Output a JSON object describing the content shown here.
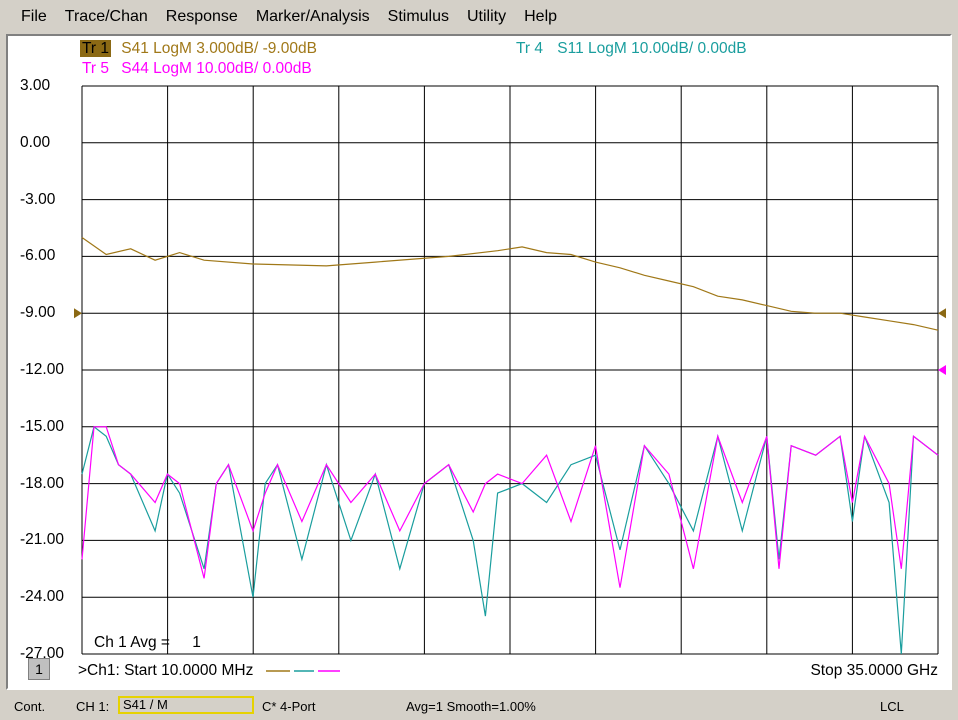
{
  "menu": [
    "File",
    "Trace/Chan",
    "Response",
    "Marker/Analysis",
    "Stimulus",
    "Utility",
    "Help"
  ],
  "traces": {
    "tr1": {
      "name": "Tr 1",
      "desc": "S41 LogM 3.000dB/ -9.00dB",
      "color": "#a07818"
    },
    "tr4": {
      "name": "Tr 4",
      "desc": "S11 LogM 10.00dB/  0.00dB",
      "color": "#1a9e9e"
    },
    "tr5": {
      "name": "Tr 5",
      "desc": "S44 LogM 10.00dB/  0.00dB",
      "color": "#ff00ff"
    }
  },
  "y_scale_labels": [
    "3.00",
    "0.00",
    "-3.00",
    "-6.00",
    "-9.00",
    "-12.00",
    "-15.00",
    "-18.00",
    "-21.00",
    "-24.00",
    "-27.00"
  ],
  "avg_label": "Ch 1 Avg =",
  "avg_value": "1",
  "channel_box": "1",
  "start_text": ">Ch1:  Start  10.0000 MHz",
  "stop_text": "Stop  35.0000 GHz",
  "status": {
    "mode": "Cont.",
    "channel": "CH 1:",
    "meas": "S41 / M",
    "cal": "C* 4-Port",
    "avg_smooth": "Avg=1 Smooth=1.00%",
    "ref": "LCL"
  },
  "chart_data": {
    "type": "line",
    "xlabel": "",
    "ylabel": "",
    "x_range_ghz": [
      0.01,
      35.0
    ],
    "ylim": [
      -27,
      3
    ],
    "grid": true,
    "series": [
      {
        "name": "S41",
        "color": "#a07818",
        "x": [
          0.01,
          1,
          2,
          3,
          4,
          5,
          7,
          10,
          12,
          15,
          17,
          18,
          19,
          20,
          21,
          22,
          23,
          24,
          25,
          26,
          27,
          28,
          29,
          30,
          31,
          32,
          33,
          34,
          35
        ],
        "y": [
          -5.0,
          -5.9,
          -5.6,
          -6.2,
          -5.8,
          -6.2,
          -6.4,
          -6.5,
          -6.3,
          -6.0,
          -5.7,
          -5.5,
          -5.8,
          -5.9,
          -6.3,
          -6.6,
          -7.0,
          -7.3,
          -7.6,
          -8.1,
          -8.3,
          -8.6,
          -8.9,
          -9.0,
          -9.0,
          -9.2,
          -9.4,
          -9.6,
          -9.9
        ]
      },
      {
        "name": "S11",
        "color": "#1a9e9e",
        "x": [
          0.01,
          0.5,
          1,
          1.5,
          2,
          3,
          3.5,
          4,
          5,
          5.5,
          6,
          7,
          7.5,
          8,
          9,
          10,
          11,
          12,
          13,
          14,
          15,
          16,
          16.5,
          17,
          18,
          19,
          20,
          21,
          22,
          23,
          24,
          25,
          26,
          27,
          28,
          28.5,
          29,
          30,
          31,
          31.5,
          32,
          33,
          33.5,
          34,
          35
        ],
        "y": [
          -17.5,
          -15,
          -15.5,
          -17.0,
          -17.5,
          -20.5,
          -17.5,
          -18.5,
          -22.5,
          -18.0,
          -17.0,
          -24.0,
          -18.0,
          -17.0,
          -22.0,
          -17.0,
          -21.0,
          -17.5,
          -22.5,
          -18.0,
          -17.0,
          -21.0,
          -25.0,
          -18.5,
          -18.0,
          -19.0,
          -17.0,
          -16.5,
          -21.5,
          -16.0,
          -18.0,
          -20.5,
          -15.5,
          -20.5,
          -15.5,
          -22.0,
          -16.0,
          -16.5,
          -15.5,
          -20.0,
          -15.5,
          -19.0,
          -27.0,
          -15.5,
          -16.5
        ]
      },
      {
        "name": "S44",
        "color": "#ff00ff",
        "x": [
          0.01,
          0.5,
          1,
          1.5,
          2,
          3,
          3.5,
          4,
          5,
          5.5,
          6,
          7,
          7.5,
          8,
          9,
          10,
          11,
          12,
          13,
          14,
          15,
          16,
          16.5,
          17,
          18,
          19,
          20,
          21,
          22,
          23,
          24,
          25,
          26,
          27,
          28,
          28.5,
          29,
          30,
          31,
          31.5,
          32,
          33,
          33.5,
          34,
          35
        ],
        "y": [
          -22.0,
          -15,
          -15.0,
          -17.0,
          -17.5,
          -19.0,
          -17.5,
          -18.0,
          -23.0,
          -18.0,
          -17.0,
          -20.5,
          -18.5,
          -17.0,
          -20.0,
          -17.0,
          -19.0,
          -17.5,
          -20.5,
          -18.0,
          -17.0,
          -19.5,
          -18.0,
          -17.5,
          -18.0,
          -16.5,
          -20.0,
          -16.0,
          -23.5,
          -16.0,
          -17.5,
          -22.5,
          -15.5,
          -19.0,
          -15.5,
          -22.5,
          -16.0,
          -16.5,
          -15.5,
          -19.0,
          -15.5,
          -18.0,
          -22.5,
          -15.5,
          -16.5
        ]
      }
    ]
  }
}
